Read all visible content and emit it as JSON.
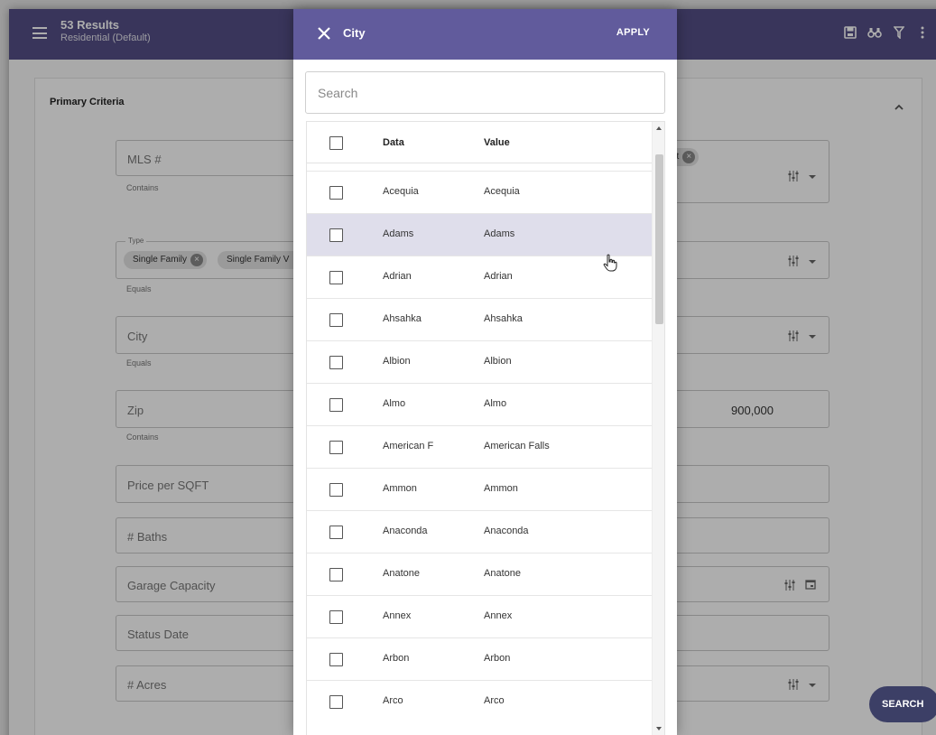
{
  "app": {
    "results_title": "53 Results",
    "results_subtitle": "Residential (Default)",
    "toolbar_icons": [
      "save-icon",
      "binoculars-icon",
      "filter-icon",
      "more-vert-icon"
    ],
    "section_title": "Primary Criteria",
    "search_button": "SEARCH",
    "fields": {
      "mls": {
        "placeholder": "MLS #",
        "hint": "Contains"
      },
      "type": {
        "legend": "Type",
        "chips": [
          "Single Family",
          "Single Family V"
        ],
        "hint": "Equals"
      },
      "city": {
        "placeholder": "City",
        "hint": "Equals"
      },
      "zip": {
        "placeholder": "Zip",
        "hint": "Contains"
      },
      "price_per_sqft": {
        "placeholder": "Price per SQFT"
      },
      "baths": {
        "placeholder": "# Baths"
      },
      "garage": {
        "placeholder": "Garage Capacity"
      },
      "status_date": {
        "placeholder": "Status Date"
      },
      "acres": {
        "placeholder": "# Acres"
      }
    },
    "right_column": {
      "chip_fragment": "et",
      "price_value": "900,000"
    }
  },
  "dialog": {
    "title": "City",
    "apply_label": "APPLY",
    "search_placeholder": "Search",
    "columns": {
      "data": "Data",
      "value": "Value"
    },
    "highlighted_row": "Adams",
    "rows": [
      {
        "data": "Acequia",
        "value": "Acequia"
      },
      {
        "data": "Adams",
        "value": "Adams"
      },
      {
        "data": "Adrian",
        "value": "Adrian"
      },
      {
        "data": "Ahsahka",
        "value": "Ahsahka"
      },
      {
        "data": "Albion",
        "value": "Albion"
      },
      {
        "data": "Almo",
        "value": "Almo"
      },
      {
        "data": "American F",
        "value": "American Falls"
      },
      {
        "data": "Ammon",
        "value": "Ammon"
      },
      {
        "data": "Anaconda",
        "value": "Anaconda"
      },
      {
        "data": "Anatone",
        "value": "Anatone"
      },
      {
        "data": "Annex",
        "value": "Annex"
      },
      {
        "data": "Arbon",
        "value": "Arbon"
      },
      {
        "data": "Arco",
        "value": "Arco"
      }
    ]
  },
  "colors": {
    "app_header": "#544f87",
    "dialog_header": "#615b9c",
    "row_highlight": "#dfdeeb",
    "fab": "#3c3f66"
  }
}
